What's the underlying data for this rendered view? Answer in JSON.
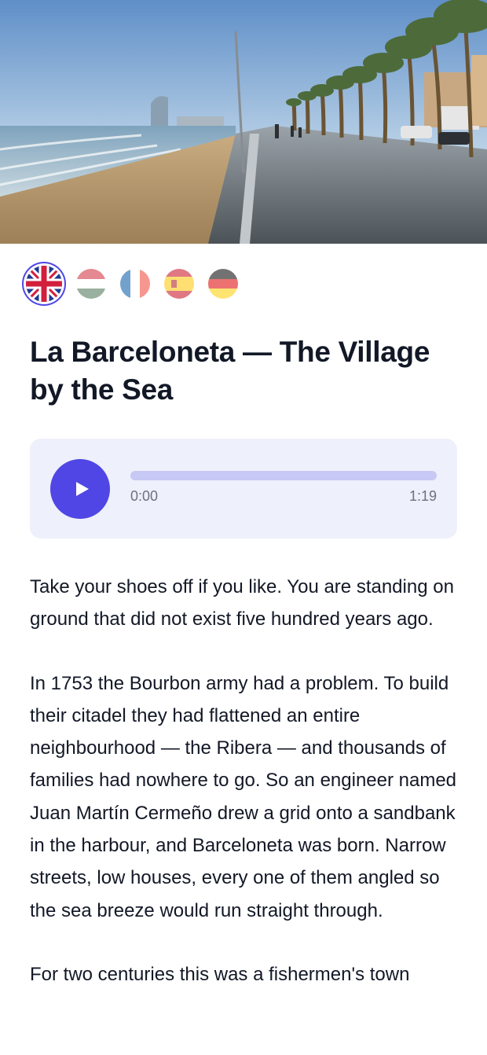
{
  "languages": [
    {
      "name": "English",
      "icon": "uk-flag-icon",
      "active": true
    },
    {
      "name": "Hungarian",
      "icon": "hungary-flag-icon",
      "active": false
    },
    {
      "name": "French",
      "icon": "france-flag-icon",
      "active": false
    },
    {
      "name": "Spanish",
      "icon": "spain-flag-icon",
      "active": false
    },
    {
      "name": "German",
      "icon": "germany-flag-icon",
      "active": false
    }
  ],
  "title": "La Barceloneta — The Village by the Sea",
  "audio": {
    "current_time": "0:00",
    "duration": "1:19",
    "progress": 0.0
  },
  "paragraphs": [
    "Take your shoes off if you like. You are standing on ground that did not exist five hundred years ago.",
    "In 1753 the Bourbon army had a problem. To build their citadel they had flattened an entire neighbourhood — the Ribera — and thousands of families had nowhere to go. So an engineer named Juan Martín Cermeño drew a grid onto a sandbank in the harbour, and Barceloneta was born. Narrow streets, low houses, every one of them angled so the sea breeze would run straight through.",
    "For two centuries this was a fishermen's town"
  ],
  "colors": {
    "accent": "#4f46e5",
    "player_bg": "#eef0fb",
    "track": "#c7c8f4",
    "text": "#121826",
    "muted": "#6b7280"
  }
}
